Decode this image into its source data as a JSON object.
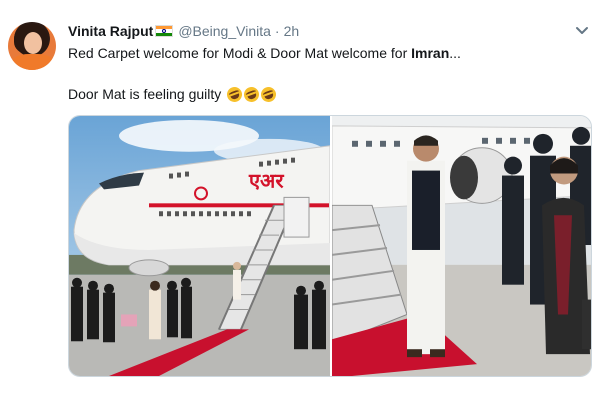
{
  "tweet": {
    "display_name": "Vinita Rajput",
    "handle": "@Being_Vinita",
    "separator": "·",
    "time": "2h",
    "line1_prefix": "Red Carpet welcome for Modi & Door Mat welcome for ",
    "line1_bold": "Imran",
    "line1_suffix": "...",
    "line2": "Door Mat is feeling guilty",
    "emoji_count": 3,
    "emoji_name": "rolling-on-floor-laughing",
    "flag_name": "india-flag",
    "menu_icon": "chevron-down-icon"
  },
  "media": {
    "left_photo": {
      "plane_livery_text": "एअर"
    },
    "right_photo": {}
  },
  "colors": {
    "text": "#14171a",
    "secondary_text": "#657786",
    "red_carpet": "#c8102e",
    "air_india_red": "#d3122a"
  }
}
